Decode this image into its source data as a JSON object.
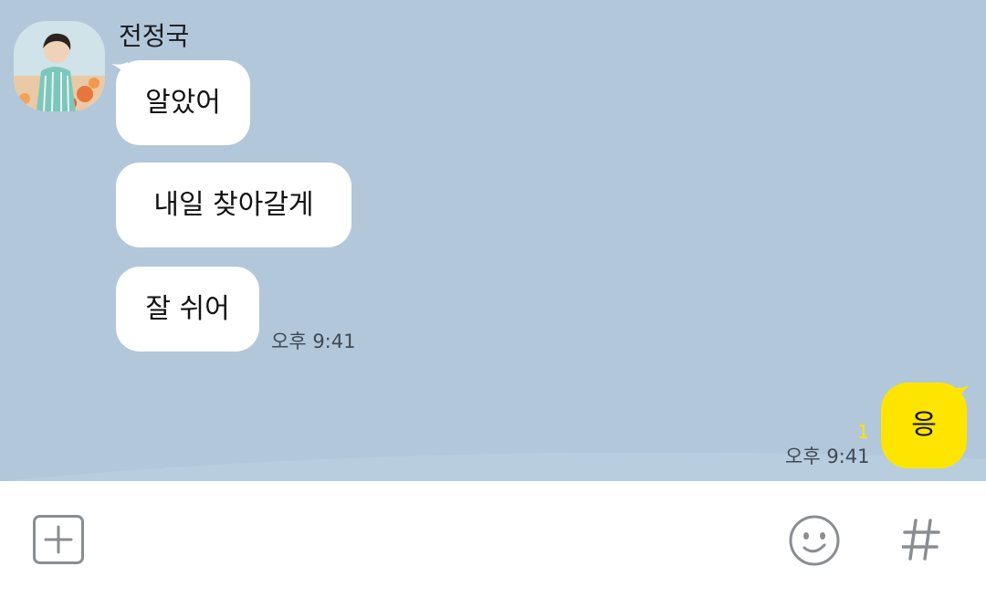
{
  "chat": {
    "sender_name": "전정국",
    "incoming": [
      {
        "text": "알았어"
      },
      {
        "text": "내일 찾아갈게"
      },
      {
        "text": "잘 쉬어"
      }
    ],
    "incoming_time": "오후 9:41",
    "outgoing": {
      "text": "응",
      "unread_count": "1",
      "time": "오후 9:41"
    }
  },
  "input_bar": {
    "icons": [
      "plus-icon",
      "emoji-icon",
      "hashtag-icon"
    ]
  },
  "colors": {
    "chat_background": "#b2c7da",
    "outgoing_bubble": "#fee500",
    "incoming_bubble": "#ffffff",
    "unread_badge": "#fee500"
  }
}
